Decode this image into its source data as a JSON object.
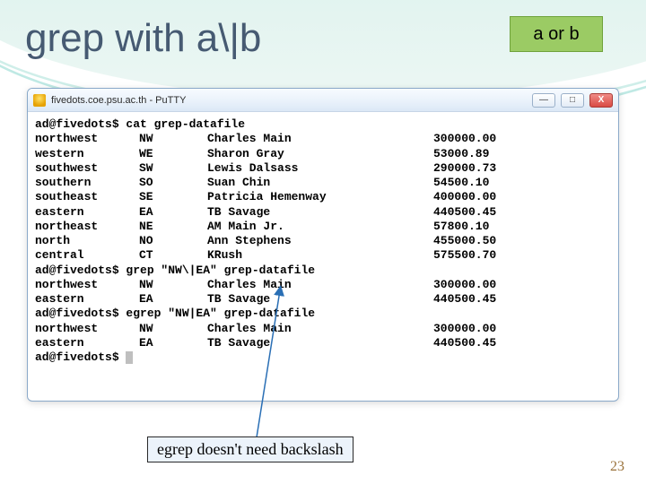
{
  "slide": {
    "title": "grep with a\\|b",
    "badge": "a or b",
    "note": "egrep doesn't need backslash",
    "page_number": "23"
  },
  "window": {
    "title": "fivedots.coe.psu.ac.th - PuTTY",
    "btn_min": "—",
    "btn_max": "□",
    "btn_close": "X"
  },
  "terminal": {
    "prompt": "ad@fivedots$",
    "cmd0": "cat grep-datafile",
    "cmd1": "grep \"NW\\|EA\" grep-datafile",
    "cmd2": "egrep \"NW|EA\" grep-datafile",
    "rows_full": [
      {
        "region": "northwest",
        "code": "NW",
        "name": "Charles Main",
        "value": "300000.00"
      },
      {
        "region": "western",
        "code": "WE",
        "name": "Sharon Gray",
        "value": "53000.89"
      },
      {
        "region": "southwest",
        "code": "SW",
        "name": "Lewis Dalsass",
        "value": "290000.73"
      },
      {
        "region": "southern",
        "code": "SO",
        "name": "Suan Chin",
        "value": "54500.10"
      },
      {
        "region": "southeast",
        "code": "SE",
        "name": "Patricia Hemenway",
        "value": "400000.00"
      },
      {
        "region": "eastern",
        "code": "EA",
        "name": "TB Savage",
        "value": "440500.45"
      },
      {
        "region": "northeast",
        "code": "NE",
        "name": "AM Main Jr.",
        "value": "57800.10"
      },
      {
        "region": "north",
        "code": "NO",
        "name": "Ann Stephens",
        "value": "455000.50"
      },
      {
        "region": "central",
        "code": "CT",
        "name": "KRush",
        "value": "575500.70"
      }
    ],
    "rows_grep": [
      {
        "region": "northwest",
        "code": "NW",
        "name": "Charles Main",
        "value": "300000.00"
      },
      {
        "region": "eastern",
        "code": "EA",
        "name": "TB Savage",
        "value": "440500.45"
      }
    ],
    "rows_egrep": [
      {
        "region": "northwest",
        "code": "NW",
        "name": "Charles Main",
        "value": "300000.00"
      },
      {
        "region": "eastern",
        "code": "EA",
        "name": "TB Savage",
        "value": "440500.45"
      }
    ]
  }
}
